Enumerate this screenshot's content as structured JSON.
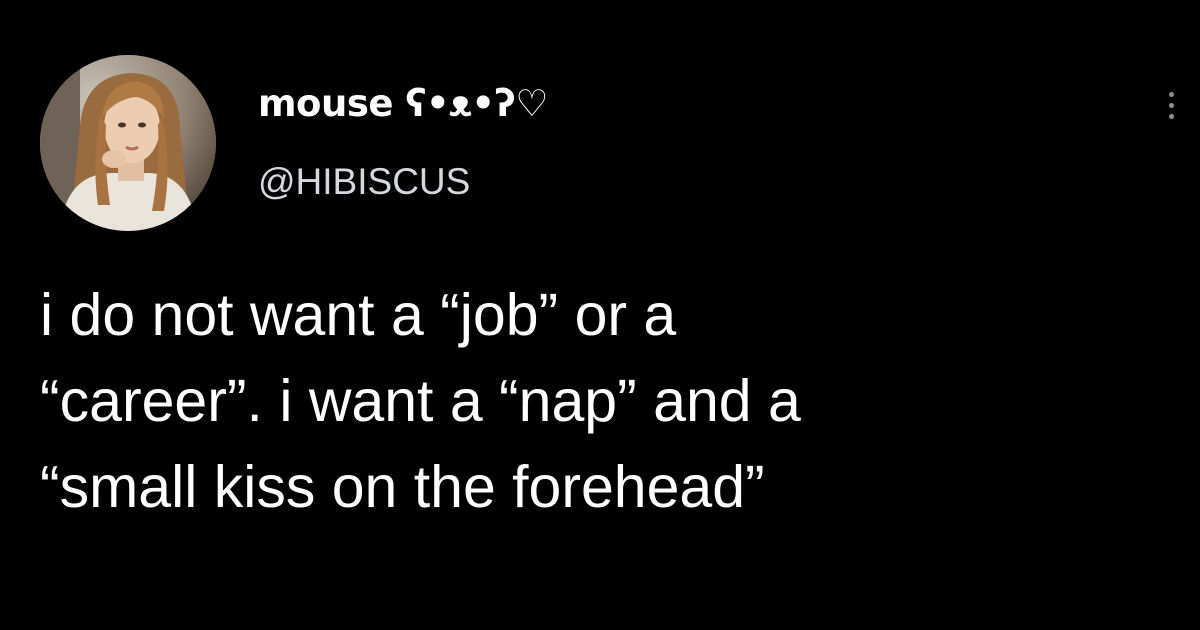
{
  "tweet": {
    "author": {
      "display_name": "mouse ʕ•ᴥ•ʔ♡",
      "handle": "@HIBISCUS",
      "avatar": "profile-photo"
    },
    "text_lines": [
      "i do not want a “job” or a",
      "“career”. i want a “nap” and a",
      "“small kiss on the forehead”"
    ],
    "more_icon": "more-horizontal-dots-icon"
  },
  "colors": {
    "background": "#000000",
    "text": "#ffffff",
    "handle": "#d5d8dc",
    "icon": "#8b9198"
  }
}
